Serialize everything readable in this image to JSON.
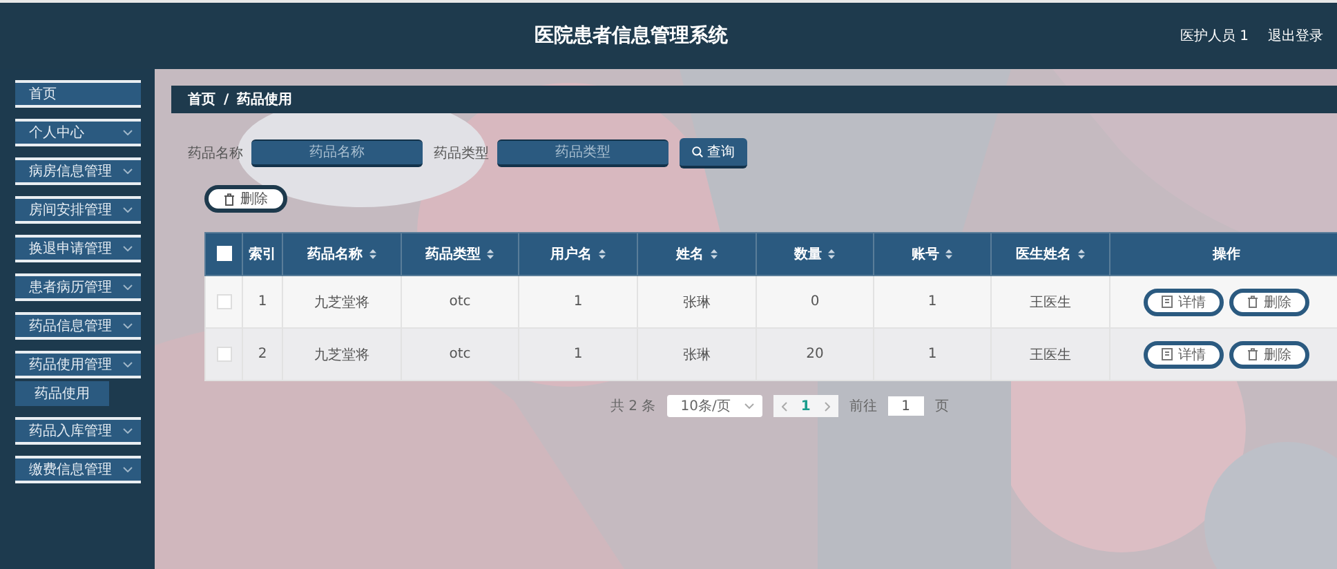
{
  "header": {
    "title": "医院患者信息管理系统",
    "user": "医护人员 1",
    "logout": "退出登录"
  },
  "sidebar": {
    "items": [
      {
        "label": "首页",
        "kind": "link"
      },
      {
        "label": "个人中心",
        "kind": "submenu"
      },
      {
        "label": "病房信息管理",
        "kind": "submenu"
      },
      {
        "label": "房间安排管理",
        "kind": "submenu"
      },
      {
        "label": "换退申请管理",
        "kind": "submenu"
      },
      {
        "label": "患者病历管理",
        "kind": "submenu"
      },
      {
        "label": "药品信息管理",
        "kind": "submenu"
      },
      {
        "label": "药品使用管理",
        "kind": "submenu",
        "children": [
          {
            "label": "药品使用"
          }
        ]
      },
      {
        "label": "药品入库管理",
        "kind": "submenu"
      },
      {
        "label": "缴费信息管理",
        "kind": "submenu"
      }
    ]
  },
  "breadcrumb": {
    "items": [
      "首页",
      "药品使用"
    ],
    "separator": "/"
  },
  "search": {
    "fields": [
      {
        "label": "药品名称",
        "placeholder": "药品名称"
      },
      {
        "label": "药品类型",
        "placeholder": "药品类型"
      }
    ],
    "button": "查询"
  },
  "delete_button": "删除",
  "table": {
    "select_all_checked": false,
    "columns": [
      {
        "label": "索引",
        "sortable": false
      },
      {
        "label": "药品名称",
        "sortable": true
      },
      {
        "label": "药品类型",
        "sortable": true
      },
      {
        "label": "用户名",
        "sortable": true
      },
      {
        "label": "姓名",
        "sortable": true
      },
      {
        "label": "数量",
        "sortable": true
      },
      {
        "label": "账号",
        "sortable": true
      },
      {
        "label": "医生姓名",
        "sortable": true
      },
      {
        "label": "操作",
        "sortable": false
      }
    ],
    "rows": [
      {
        "checked": false,
        "cells": [
          "1",
          "九芝堂将",
          "otc",
          "1",
          "张琳",
          "0",
          "1",
          "王医生"
        ],
        "actions": [
          {
            "label": "详情",
            "kind": "detail"
          },
          {
            "label": "删除",
            "kind": "delete"
          }
        ]
      },
      {
        "checked": false,
        "cells": [
          "2",
          "九芝堂将",
          "otc",
          "1",
          "张琳",
          "20",
          "1",
          "王医生"
        ],
        "actions": [
          {
            "label": "详情",
            "kind": "detail"
          },
          {
            "label": "删除",
            "kind": "delete"
          }
        ]
      }
    ]
  },
  "pagination": {
    "total": "共 2 条",
    "page_size": "10条/页",
    "pages": [
      {
        "label": "1",
        "selected": true
      }
    ],
    "goto_label": "前往",
    "goto_value": "1",
    "goto_suffix": "页"
  }
}
